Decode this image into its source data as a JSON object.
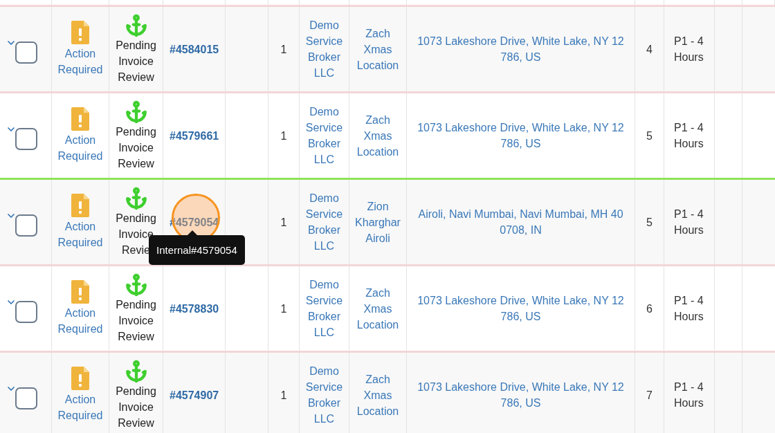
{
  "rows": [
    {
      "expanded": false,
      "checked": false,
      "action": "Action Required",
      "status": "Pending Invoice Review",
      "id": "#4584015",
      "quantity": "1",
      "broker": "Demo Service Broker LLC",
      "location": "Zach Xmas Location",
      "address": "1073 Lakeshore Drive, White Lake, NY 12 786, US",
      "count": "4",
      "priority": "P1 - 4 Hours",
      "highlighted": false
    },
    {
      "expanded": false,
      "checked": false,
      "action": "Action Required",
      "status": "Pending Invoice Review",
      "id": "#4579661",
      "quantity": "1",
      "broker": "Demo Service Broker LLC",
      "location": "Zach Xmas Location",
      "address": "1073 Lakeshore Drive, White Lake, NY 12 786, US",
      "count": "5",
      "priority": "P1 - 4 Hours",
      "highlighted": false
    },
    {
      "expanded": false,
      "checked": false,
      "action": "Action Required",
      "status": "Pending Invoice Revie",
      "id": "#4579054",
      "quantity": "1",
      "broker": "Demo Service Broker LLC",
      "location": "Zion Kharghar Airoli",
      "address": "Airoli, Navi Mumbai, Navi Mumbai, MH 40 0708, IN",
      "count": "5",
      "priority": "P1 - 4 Hours",
      "highlighted": true
    },
    {
      "expanded": false,
      "checked": false,
      "action": "Action Required",
      "status": "Pending Invoice Review",
      "id": "#4578830",
      "quantity": "1",
      "broker": "Demo Service Broker LLC",
      "location": "Zach Xmas Location",
      "address": "1073 Lakeshore Drive, White Lake, NY 12 786, US",
      "count": "6",
      "priority": "P1 - 4 Hours",
      "highlighted": false
    },
    {
      "expanded": false,
      "checked": false,
      "action": "Action Required",
      "status": "Pending Invoice Review",
      "id": "#4574907",
      "quantity": "1",
      "broker": "Demo Service Broker LLC",
      "location": "Zach Xmas Location",
      "address": "1073 Lakeshore Drive, White Lake, NY 12 786, US",
      "count": "7",
      "priority": "P1 - 4 Hours",
      "highlighted": false
    }
  ],
  "tooltip": {
    "text": "Internal#4579054"
  }
}
